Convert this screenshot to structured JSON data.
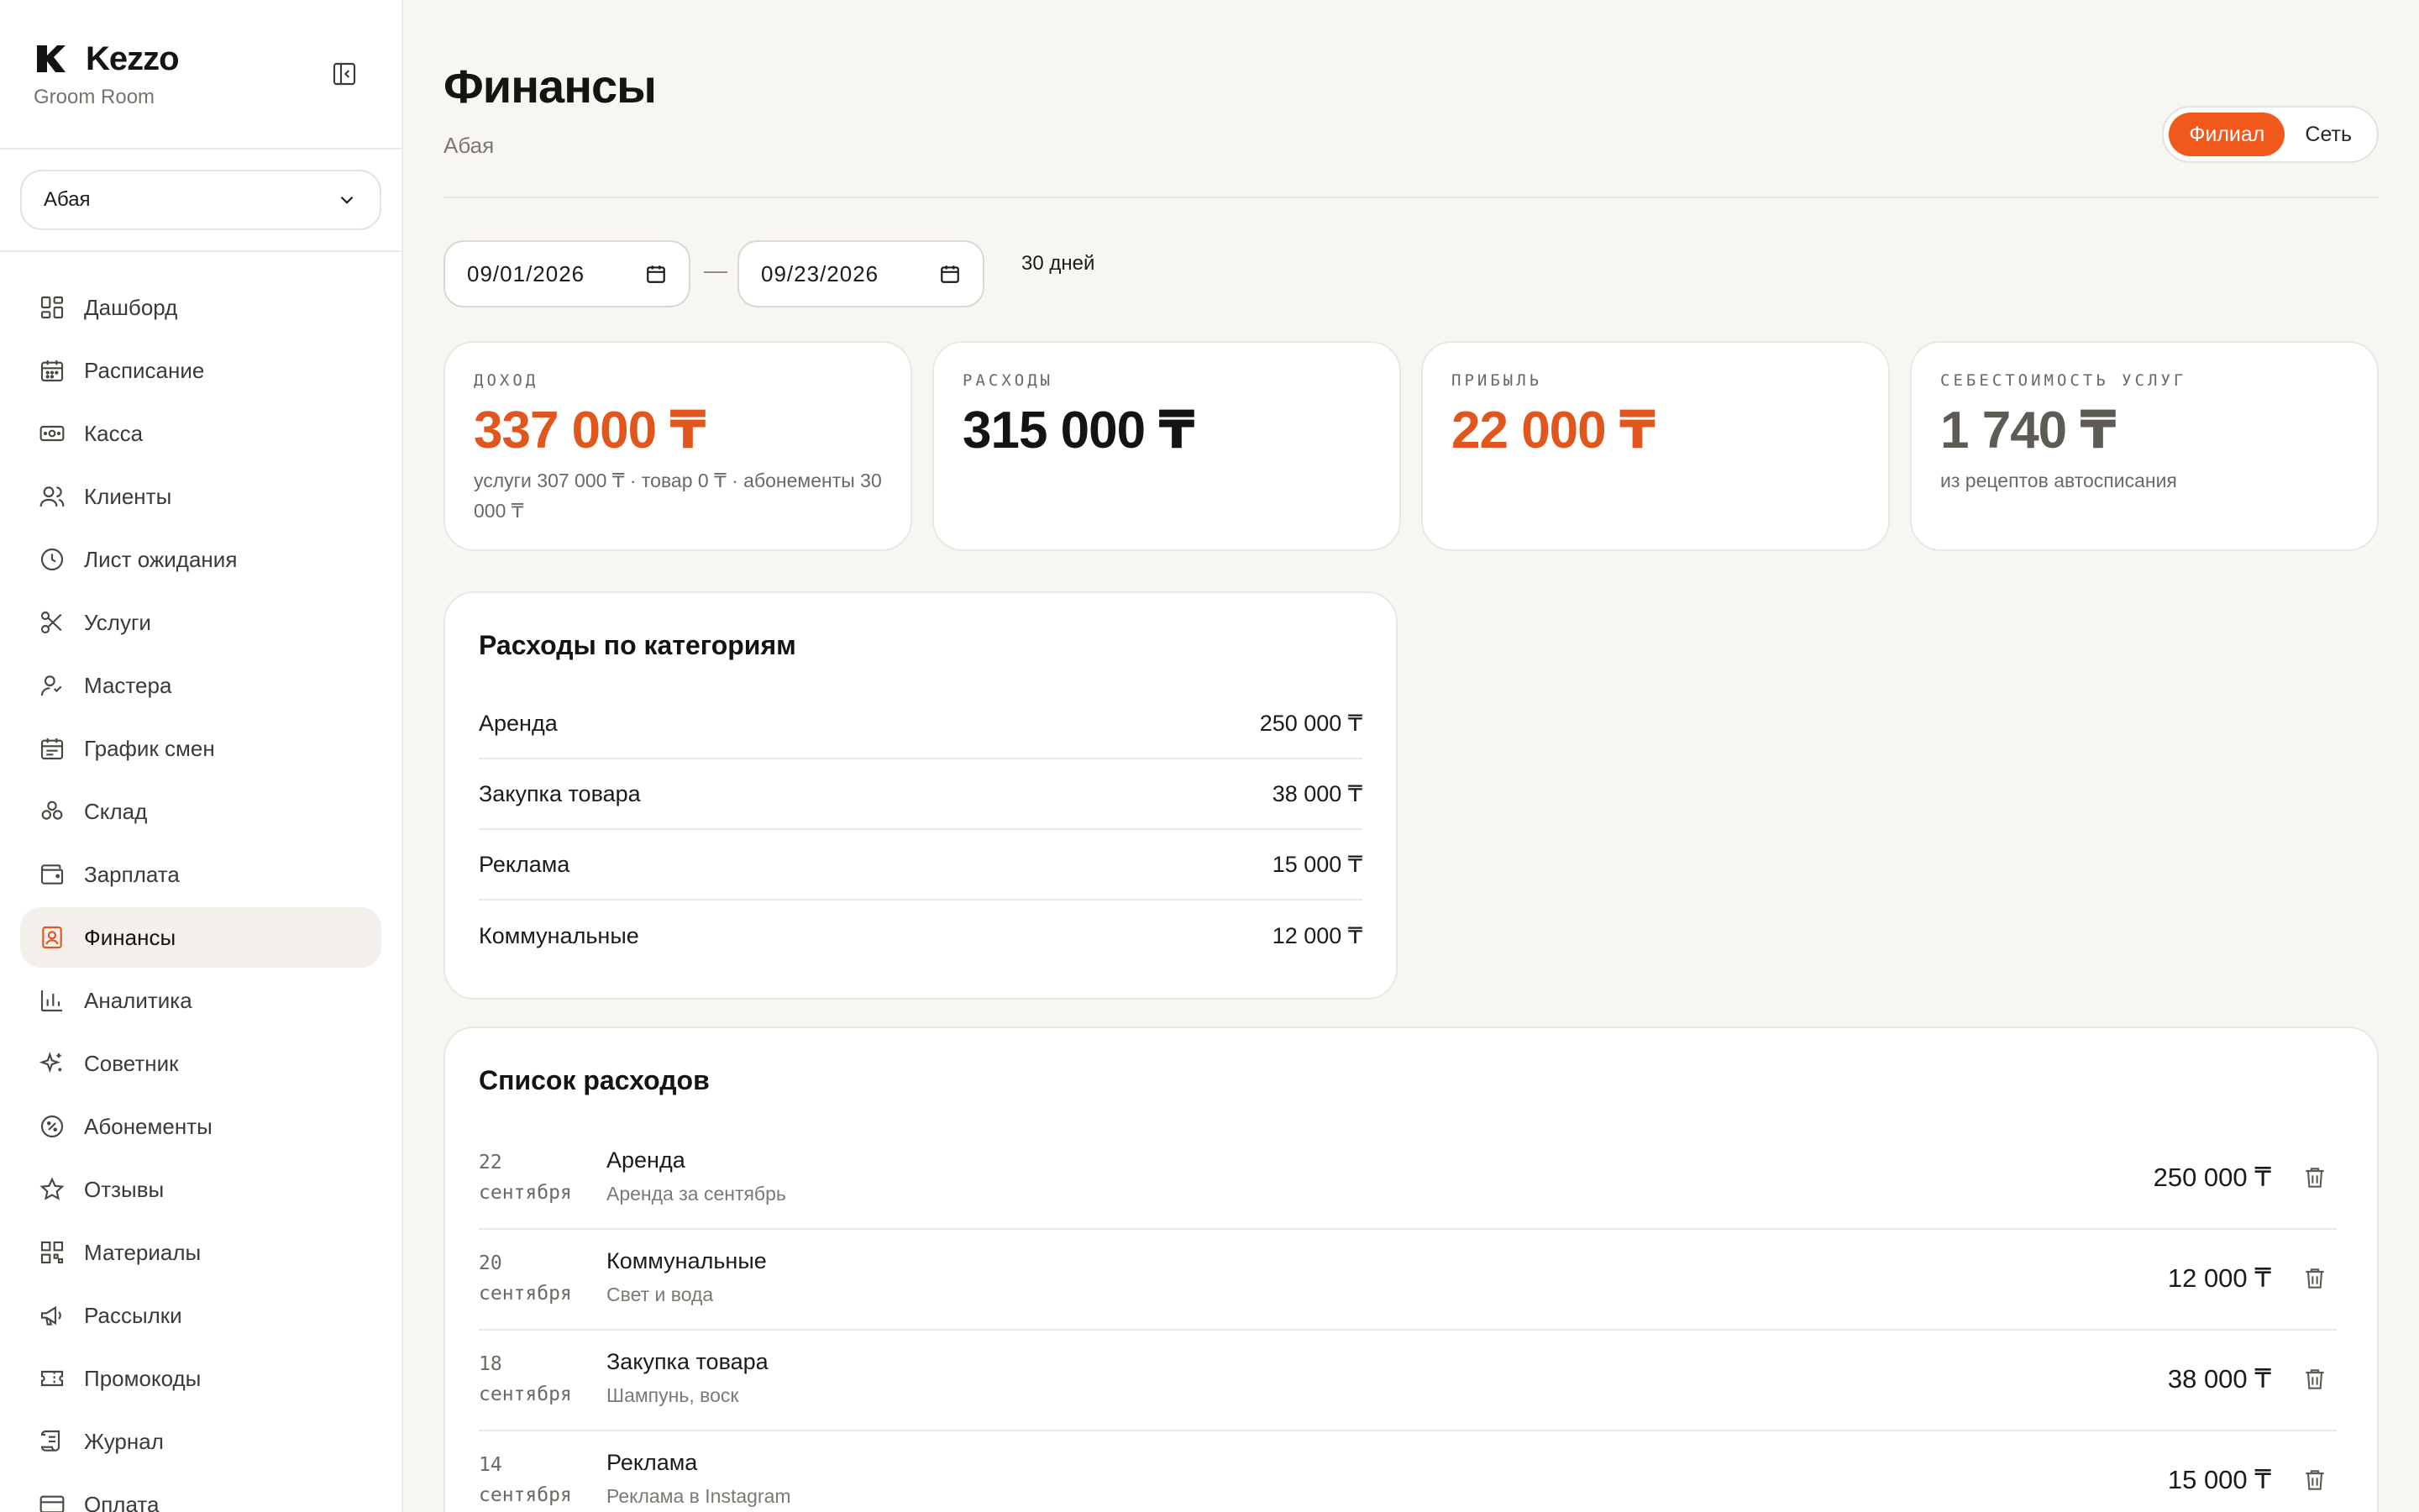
{
  "brand": {
    "name": "Kezzo",
    "subtitle": "Groom Room"
  },
  "sidebar": {
    "branch_select": {
      "value": "Абая"
    },
    "items": [
      {
        "label": "Дашборд",
        "icon": "dashboard-icon"
      },
      {
        "label": "Расписание",
        "icon": "calendar-icon"
      },
      {
        "label": "Касса",
        "icon": "cash-icon"
      },
      {
        "label": "Клиенты",
        "icon": "users-icon"
      },
      {
        "label": "Лист ожидания",
        "icon": "clock-icon"
      },
      {
        "label": "Услуги",
        "icon": "scissors-icon"
      },
      {
        "label": "Мастера",
        "icon": "masters-icon"
      },
      {
        "label": "График смен",
        "icon": "schedule-icon"
      },
      {
        "label": "Склад",
        "icon": "boxes-icon"
      },
      {
        "label": "Зарплата",
        "icon": "wallet-icon"
      },
      {
        "label": "Финансы",
        "icon": "finance-icon",
        "active": true
      },
      {
        "label": "Аналитика",
        "icon": "chart-icon"
      },
      {
        "label": "Советник",
        "icon": "sparkles-icon"
      },
      {
        "label": "Абонементы",
        "icon": "badge-percent-icon"
      },
      {
        "label": "Отзывы",
        "icon": "star-icon"
      },
      {
        "label": "Материалы",
        "icon": "qr-icon"
      },
      {
        "label": "Рассылки",
        "icon": "megaphone-icon"
      },
      {
        "label": "Промокоды",
        "icon": "ticket-icon"
      },
      {
        "label": "Журнал",
        "icon": "scroll-icon"
      },
      {
        "label": "Оплата",
        "icon": "card-icon"
      }
    ]
  },
  "header": {
    "title": "Финансы",
    "subtitle": "Абая",
    "scope": {
      "branch": "Филиал",
      "network": "Сеть",
      "selected": "branch"
    }
  },
  "filters": {
    "date_from": "09/01/2026",
    "date_to": "09/23/2026",
    "separator": "—",
    "range_label": "30 дней"
  },
  "kpis": [
    {
      "label": "ДОХОД",
      "value": "337 000 ₸",
      "note": "услуги 307 000 ₸ · товар 0 ₸ · абонементы 30 000 ₸",
      "color": "#e0561c"
    },
    {
      "label": "РАСХОДЫ",
      "value": "315 000 ₸",
      "note": "",
      "color": "#151412"
    },
    {
      "label": "ПРИБЫЛЬ",
      "value": "22 000 ₸",
      "note": "",
      "color": "#e0561c"
    },
    {
      "label": "СЕБЕСТОИМОСТЬ УСЛУГ",
      "value": "1 740 ₸",
      "note": "из рецептов автосписания",
      "color": "#5e5a54"
    }
  ],
  "categories": {
    "title": "Расходы по категориям",
    "rows": [
      {
        "name": "Аренда",
        "amount": "250 000 ₸"
      },
      {
        "name": "Закупка товара",
        "amount": "38 000 ₸"
      },
      {
        "name": "Реклама",
        "amount": "15 000 ₸"
      },
      {
        "name": "Коммунальные",
        "amount": "12 000 ₸"
      }
    ]
  },
  "expenses": {
    "title": "Список расходов",
    "rows": [
      {
        "day": "22",
        "month": "сентября",
        "name": "Аренда",
        "desc": "Аренда за сентябрь",
        "amount": "250 000 ₸"
      },
      {
        "day": "20",
        "month": "сентября",
        "name": "Коммунальные",
        "desc": "Свет и вода",
        "amount": "12 000 ₸"
      },
      {
        "day": "18",
        "month": "сентября",
        "name": "Закупка товара",
        "desc": "Шампунь, воск",
        "amount": "38 000 ₸"
      },
      {
        "day": "14",
        "month": "сентября",
        "name": "Реклама",
        "desc": "Реклама в Instagram",
        "amount": "15 000 ₸"
      }
    ]
  },
  "colors": {
    "accent": "#f0581c",
    "accent_text": "#e0561c",
    "background": "#f8f6f3"
  }
}
